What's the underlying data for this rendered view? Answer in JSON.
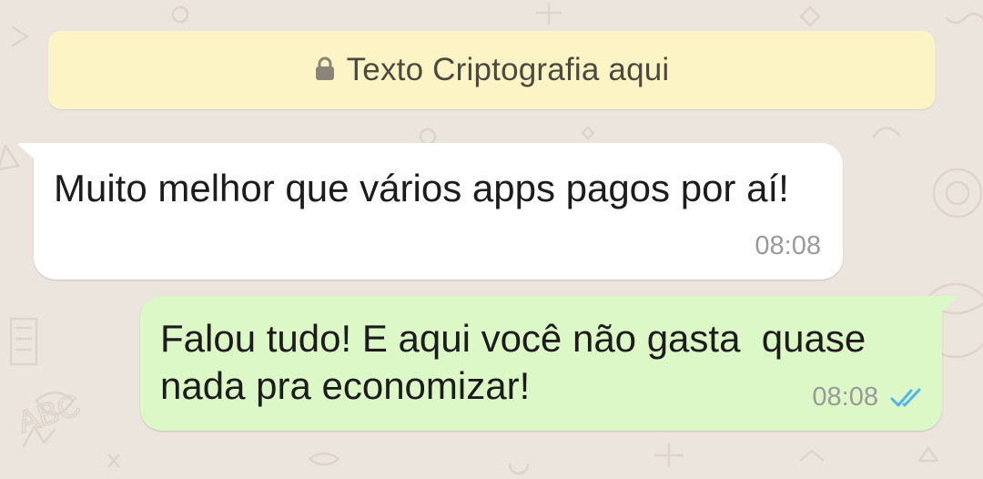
{
  "encryption_banner": {
    "text": "Texto Criptografia aqui",
    "icon": "lock-icon",
    "background": "#fdf4c5"
  },
  "messages": [
    {
      "direction": "incoming",
      "text": "Muito melhor que vários apps pagos por aí!",
      "time": "08:08",
      "background": "#ffffff"
    },
    {
      "direction": "outgoing",
      "text": "Falou tudo! E aqui você não gasta  quase nada pra economizar!",
      "time": "08:08",
      "status_icon": "double-check-icon",
      "status_color": "#4fb6ec",
      "background": "#dcf8c6"
    }
  ],
  "chat_wallpaper": {
    "background": "#ece5dd"
  }
}
